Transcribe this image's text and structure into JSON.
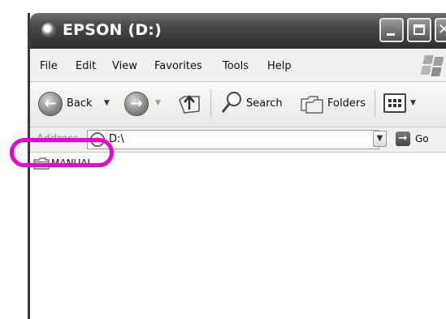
{
  "window": {
    "title": "EPSON (D:)"
  },
  "menu": {
    "items": [
      "File",
      "Edit",
      "View",
      "Favorites",
      "Tools",
      "Help"
    ]
  },
  "toolbar": {
    "back_label": "Back",
    "search_label": "Search",
    "folders_label": "Folders"
  },
  "address": {
    "label": "Address",
    "value": "D:\\",
    "go_label": "Go"
  },
  "content": {
    "items": [
      {
        "name": "MANUAL",
        "type": "folder"
      }
    ]
  },
  "annotation": {
    "highlight_color": "#f000d8"
  }
}
